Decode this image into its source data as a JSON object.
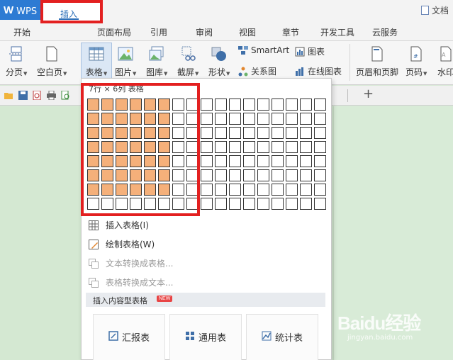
{
  "titlebar": {
    "app_name": "WPS 文字",
    "doc_title": "文档"
  },
  "menu": {
    "tabs": [
      "开始",
      "插入",
      "页面布局",
      "引用",
      "审阅",
      "视图",
      "章节",
      "开发工具",
      "云服务"
    ],
    "active": "插入"
  },
  "ribbon": {
    "page_break": "分页",
    "blank_page": "空白页",
    "table": "表格",
    "picture": "图片",
    "gallery": "图库",
    "screenshot": "截屏",
    "shape": "形状",
    "smartart": "SmartArt",
    "chart": "图表",
    "relation_chart": "关系图",
    "online_chart": "在线图表",
    "header_footer": "页眉和页脚",
    "page_number": "页码",
    "watermark": "水印"
  },
  "dropdown": {
    "grid_caption": "7行 × 6列 表格",
    "grid_rows": 8,
    "grid_cols": 17,
    "selected_rows": 7,
    "selected_cols": 6,
    "insert_table": "插入表格(I)",
    "draw_table": "绘制表格(W)",
    "text_to_table": "文本转换成表格...",
    "table_to_text": "表格转换成文本...",
    "content_section": "插入内容型表格",
    "new_badge": "NEW",
    "templates": [
      "汇报表",
      "通用表",
      "统计表"
    ]
  },
  "watermark": {
    "brand": "Baidu经验",
    "url": "jingyan.baidu.com"
  },
  "colors": {
    "accent": "#2d7bd3",
    "highlight_cell": "#f5b07a",
    "annotation": "#e32020",
    "doc_bg": "#d4e8d2"
  }
}
